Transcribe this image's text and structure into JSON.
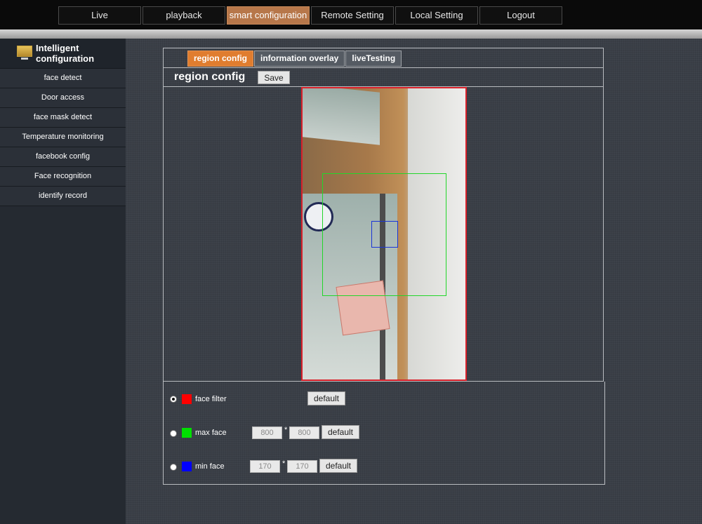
{
  "nav": [
    "Live",
    "playback",
    "smart configuration",
    "Remote Setting",
    "Local Setting",
    "Logout"
  ],
  "nav_active": "smart configuration",
  "sidebar": {
    "title": "Intelligent configuration",
    "icon": "monitor-icon",
    "items": [
      "face detect",
      "Door access",
      "face mask detect",
      "Temperature monitoring",
      "facebook config",
      "Face recognition",
      "identify record"
    ]
  },
  "tabs": [
    "region config",
    "information overlay",
    "liveTesting"
  ],
  "page_title": "region config",
  "save_label": "Save",
  "controls": {
    "face_filter": {
      "label": "face filter",
      "color": "#ff0000",
      "default_label": "default",
      "selected": true
    },
    "max_face": {
      "label": "max face",
      "color": "#00e000",
      "width": "800",
      "height": "800",
      "separator": "*",
      "default_label": "default"
    },
    "min_face": {
      "label": "min face",
      "color": "#0000ff",
      "width": "170",
      "height": "170",
      "separator": "*",
      "default_label": "default"
    }
  }
}
